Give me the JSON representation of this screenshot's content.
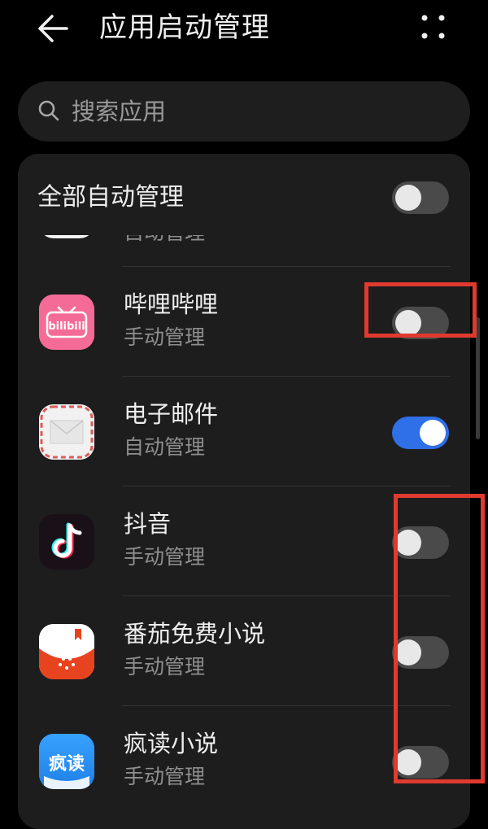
{
  "header": {
    "back_icon": "arrow-left-icon",
    "title": "应用启动管理",
    "more_icon": "more-grid-icon"
  },
  "search": {
    "icon": "search-icon",
    "placeholder": "搜索应用"
  },
  "all_toggle": {
    "label": "全部自动管理",
    "on": false
  },
  "partial_item": {
    "subtitle": "自动管理"
  },
  "apps": [
    {
      "name": "哔哩哔哩",
      "status": "手动管理",
      "toggle_on": false,
      "icon": "bilibili-app-icon",
      "icon_text": "bilibili",
      "icon_color": "#f56b97"
    },
    {
      "name": "电子邮件",
      "status": "自动管理",
      "toggle_on": true,
      "icon": "email-app-icon",
      "icon_color": "#f0f0f0"
    },
    {
      "name": "抖音",
      "status": "手动管理",
      "toggle_on": false,
      "icon": "douyin-app-icon",
      "icon_color": "#1a1118"
    },
    {
      "name": "番茄免费小说",
      "status": "手动管理",
      "toggle_on": false,
      "icon": "fanqie-novel-app-icon",
      "icon_color": "#e8431f"
    },
    {
      "name": "疯读小说",
      "status": "手动管理",
      "toggle_on": false,
      "icon": "fengdu-novel-app-icon",
      "icon_text": "疯读",
      "icon_color": "#2b8ff0"
    }
  ],
  "colors": {
    "background": "#000000",
    "card": "#1d1d1d",
    "toggle_on": "#2f6fe8",
    "toggle_off": "#4a4a4a",
    "annotation": "#e03a2f"
  }
}
